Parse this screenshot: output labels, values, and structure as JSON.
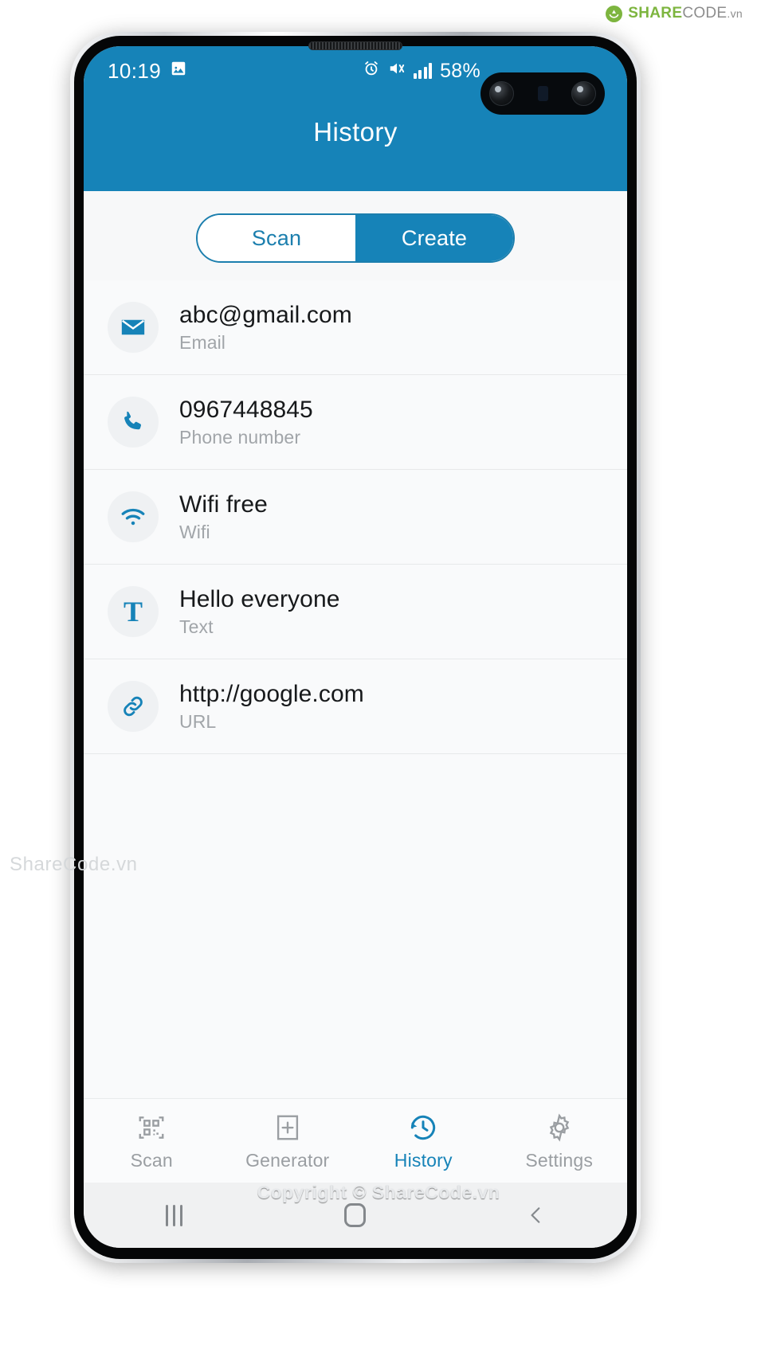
{
  "brand": {
    "mark_icon": "recycle-icon",
    "share": "SHARE",
    "code": "CODE",
    "tld": ".vn"
  },
  "watermark": "ShareCode.vn",
  "footer": {
    "copyright": "Copyright © ShareCode.vn"
  },
  "colors": {
    "primary_blue": "#1683B8",
    "accent_green": "#7DB53F",
    "screen_bg": "#f9fafb",
    "muted_text": "#a1a5a9"
  },
  "status_bar": {
    "time": "10:19",
    "gallery_icon": "image-icon",
    "alarm_icon": "alarm-icon",
    "mute_icon": "mute-vibrate-icon",
    "signal_icon": "signal-bars-icon",
    "battery": "58%"
  },
  "header": {
    "title": "History"
  },
  "segment": {
    "options": [
      {
        "label": "Scan",
        "active": false
      },
      {
        "label": "Create",
        "active": true
      }
    ]
  },
  "history": {
    "items": [
      {
        "title": "abc@gmail.com",
        "subtitle": "Email",
        "icon": "email-icon"
      },
      {
        "title": "0967448845",
        "subtitle": "Phone number",
        "icon": "phone-icon"
      },
      {
        "title": "Wifi free",
        "subtitle": "Wifi",
        "icon": "wifi-icon"
      },
      {
        "title": "Hello everyone",
        "subtitle": "Text",
        "icon": "text-icon"
      },
      {
        "title": "http://google.com",
        "subtitle": "URL",
        "icon": "link-icon"
      }
    ]
  },
  "tabbar": {
    "tabs": [
      {
        "label": "Scan",
        "icon": "qr-code-icon",
        "active": false
      },
      {
        "label": "Generator",
        "icon": "plus-box-icon",
        "active": false
      },
      {
        "label": "History",
        "icon": "clock-history-icon",
        "active": true
      },
      {
        "label": "Settings",
        "icon": "gear-icon",
        "active": false
      }
    ]
  },
  "system_nav": {
    "recents": "recents-icon",
    "home": "home-icon",
    "back": "back-icon"
  }
}
